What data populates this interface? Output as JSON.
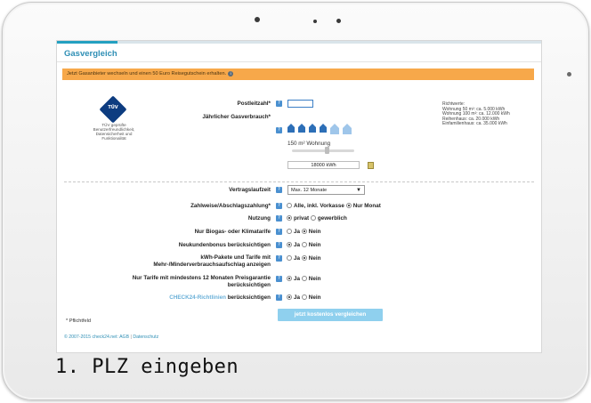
{
  "page": {
    "title": "Gasvergleich",
    "banner": "Jetzt Gasanbieter wechseln und einen 50 Euro Reisegutschein erhalten.",
    "caption": "1. PLZ eingeben"
  },
  "tuv": {
    "badge_text": "TÜV",
    "text": "TÜV geprüfte Benutzerfreundlichkeit, Datensicherheit und Funktionalität"
  },
  "form": {
    "postleitzahl_label": "Postleitzahl*",
    "gasverbrauch_label": "Jährlicher Gasverbrauch*",
    "wohnung_label": "150 m² Wohnung",
    "slider_level": 0.55,
    "kwh_value": "18000 kWh",
    "vertragslaufzeit_label": "Vertragslaufzeit",
    "vertragslaufzeit_value": "Max. 12 Monate",
    "zahlweise_label": "Zahlweise/Abschlagszahlung*",
    "zahlweise_opt1": "Alle, inkl. Vorkasse",
    "zahlweise_opt2": "Nur Monat",
    "nutzung_label": "Nutzung",
    "nutzung_opt1": "privat",
    "nutzung_opt2": "gewerblich",
    "biogas_label": "Nur Biogas- oder Klimatarife",
    "neukunden_label": "Neukundenbonus berücksichtigen",
    "kwh_pakete_label": "kWh-Pakete und Tarife mit Mehr-/Minderverbrauchsaufschlag anzeigen",
    "preisgarantie_label": "Nur Tarife mit mindestens 12 Monaten Preisgarantie berücksichtigen",
    "check24_link": "CHECK24-Richtlinien",
    "check24_rest": "berücksichtigen",
    "ja": "Ja",
    "nein": "Nein",
    "pflichtfeld": "* Pflichtfeld",
    "submit": "jetzt kostenlos vergleichen"
  },
  "richtwerte": {
    "title": "Richtwerte:",
    "lines": [
      "Wohnung 50 m²: ca. 5.000 kWh",
      "Wohnung 100 m²: ca. 12.000 kWh",
      "Reihenhaus: ca. 20.000 kWh",
      "Einfamilienhaus: ca. 35.000 kWh"
    ]
  },
  "footer": {
    "copyright": "© 2007-2015 check24.net:",
    "agb": "AGB",
    "sep": "|",
    "datenschutz": "Datenschutz"
  },
  "colors": {
    "accent": "#2f8fb5",
    "banner": "#f7a84a",
    "button": "#8fd0ee"
  },
  "icons": [
    "help-icon",
    "info-icon",
    "calculator-icon",
    "house-icon"
  ]
}
